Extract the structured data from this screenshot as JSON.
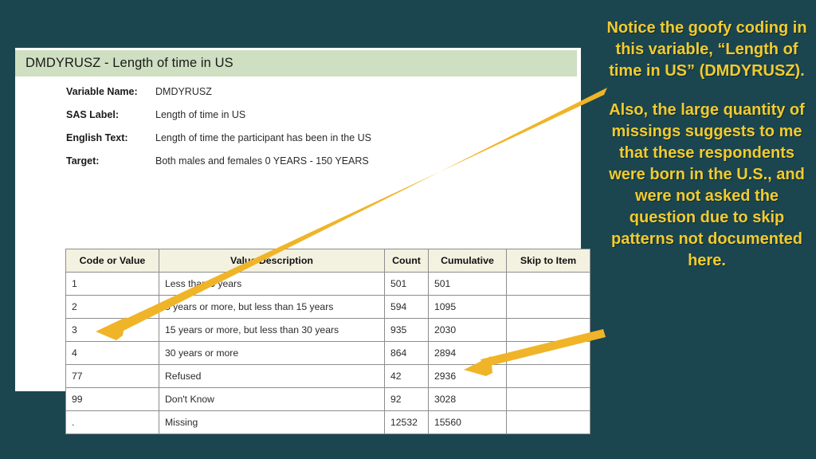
{
  "slide": {
    "background_color": "#1b4650",
    "accent_color": "#f2cb2e",
    "arrow_color": "#f0b428"
  },
  "document": {
    "header_title": "DMDYRUSZ - Length of time in US",
    "header_color": "#cfdfc1",
    "meta": [
      {
        "label": "Variable Name:",
        "value": "DMDYRUSZ"
      },
      {
        "label": "SAS Label:",
        "value": "Length of time in US"
      },
      {
        "label": "English Text:",
        "value": "Length of time the participant has been in the US"
      },
      {
        "label": "Target:",
        "value": "Both males and females 0 YEARS - 150 YEARS"
      }
    ],
    "table": {
      "columns": [
        "Code or Value",
        "Value Description",
        "Count",
        "Cumulative",
        "Skip to Item"
      ],
      "rows": [
        {
          "code": "1",
          "description": "Less than 5 years",
          "count": "501",
          "cumulative": "501",
          "skip": ""
        },
        {
          "code": "2",
          "description": "5 years or more, but less than 15 years",
          "count": "594",
          "cumulative": "1095",
          "skip": ""
        },
        {
          "code": "3",
          "description": "15 years or more, but less than 30 years",
          "count": "935",
          "cumulative": "2030",
          "skip": ""
        },
        {
          "code": "4",
          "description": "30 years or more",
          "count": "864",
          "cumulative": "2894",
          "skip": ""
        },
        {
          "code": "77",
          "description": "Refused",
          "count": "42",
          "cumulative": "2936",
          "skip": ""
        },
        {
          "code": "99",
          "description": "Don't Know",
          "count": "92",
          "cumulative": "3028",
          "skip": ""
        },
        {
          "code": ".",
          "description": "Missing",
          "count": "12532",
          "cumulative": "15560",
          "skip": ""
        }
      ]
    }
  },
  "notes": {
    "paragraph_1": "Notice the goofy coding in this variable, “Length of time in US” (DMDYRUSZ).",
    "paragraph_2": "Also, the large quantity of missings suggests to me that these respondents were born in the U.S., and were not asked the question due to skip patterns not documented here."
  },
  "annotations": {
    "arrow_1_target": "77 / Refused row code cell",
    "arrow_2_target": "15560 cumulative value"
  }
}
